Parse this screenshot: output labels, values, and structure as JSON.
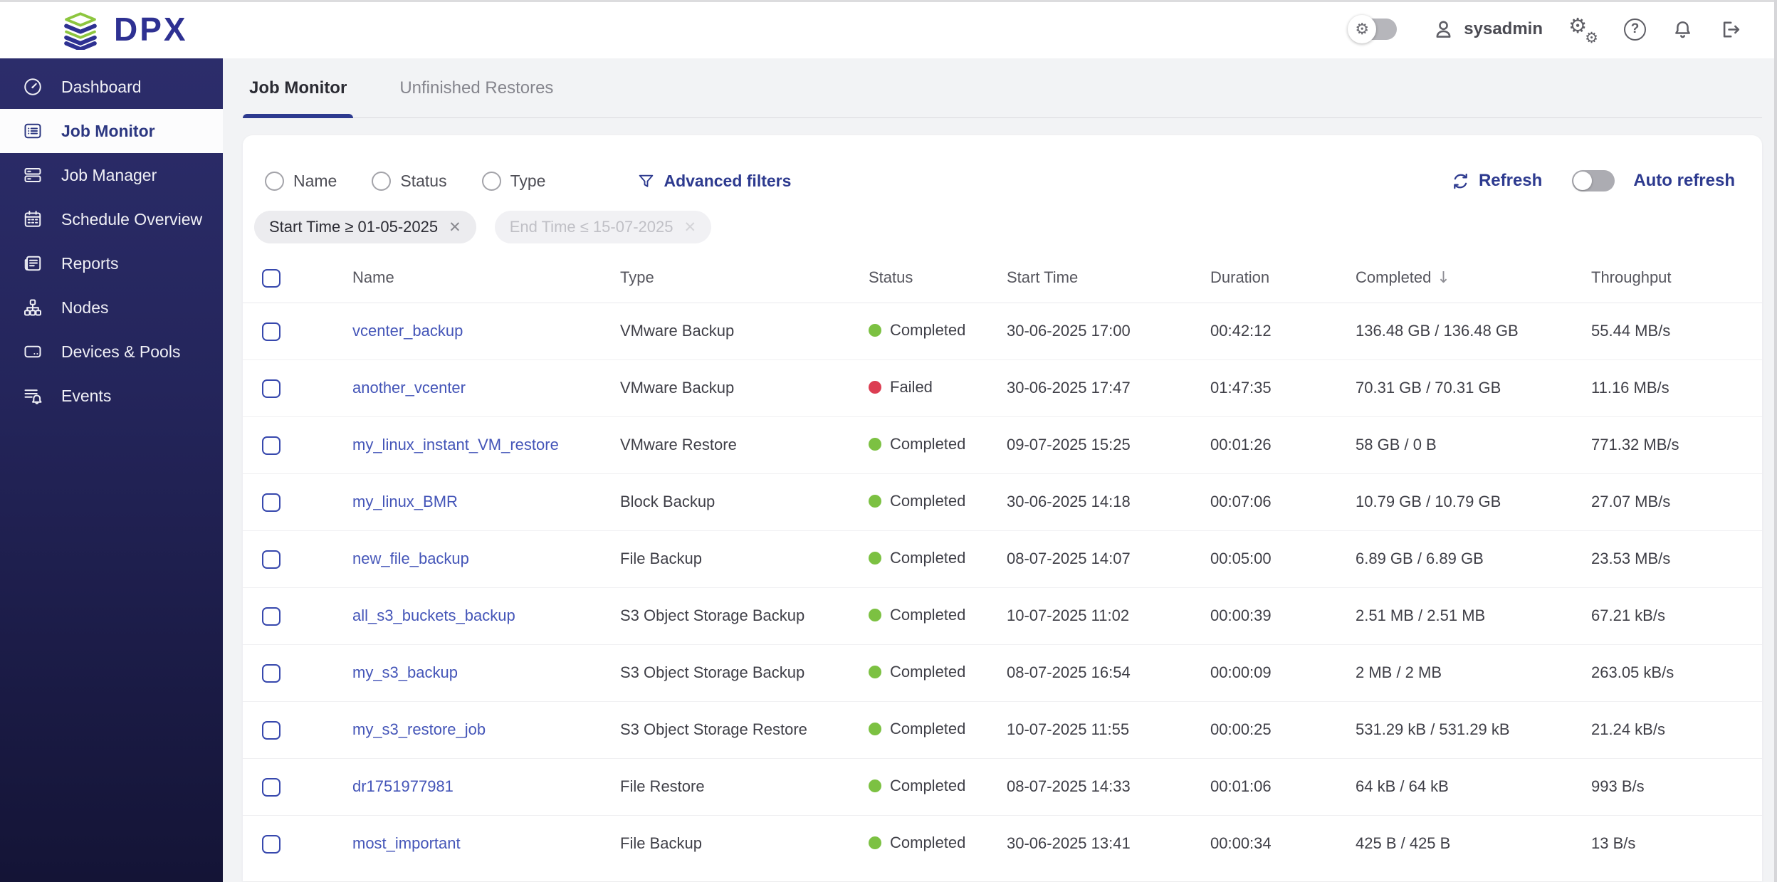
{
  "header": {
    "logo_text": "DPX",
    "username": "sysadmin",
    "gear_icon": "⚙",
    "help_icon": "?"
  },
  "sidebar": {
    "items": [
      {
        "label": "Dashboard",
        "active": false
      },
      {
        "label": "Job Monitor",
        "active": true
      },
      {
        "label": "Job Manager",
        "active": false
      },
      {
        "label": "Schedule Overview",
        "active": false
      },
      {
        "label": "Reports",
        "active": false
      },
      {
        "label": "Nodes",
        "active": false
      },
      {
        "label": "Devices & Pools",
        "active": false
      },
      {
        "label": "Events",
        "active": false
      }
    ]
  },
  "tabs": {
    "items": [
      {
        "label": "Job Monitor",
        "active": true
      },
      {
        "label": "Unfinished Restores",
        "active": false
      }
    ]
  },
  "filters": {
    "radios": [
      "Name",
      "Status",
      "Type"
    ],
    "advanced_label": "Advanced filters",
    "chips": [
      {
        "label": "Start Time ≥ 01-05-2025",
        "enabled": true
      },
      {
        "label": "End Time ≤ 15-07-2025",
        "enabled": false
      }
    ],
    "close_icon": "✕",
    "refresh_label": "Refresh",
    "auto_refresh_label": "Auto refresh",
    "auto_refresh_on": false
  },
  "table": {
    "columns": [
      "Name",
      "Type",
      "Status",
      "Start Time",
      "Duration",
      "Completed",
      "Throughput"
    ],
    "sort_column": "Completed",
    "sort_direction": "desc",
    "sort_icon": "↓",
    "rows": [
      {
        "name": "vcenter_backup",
        "type": "VMware Backup",
        "status": "Completed",
        "start_time": "30-06-2025 17:00",
        "duration": "00:42:12",
        "completed": "136.48 GB / 136.48 GB",
        "throughput": "55.44 MB/s"
      },
      {
        "name": "another_vcenter",
        "type": "VMware Backup",
        "status": "Failed",
        "start_time": "30-06-2025 17:47",
        "duration": "01:47:35",
        "completed": "70.31 GB / 70.31 GB",
        "throughput": "11.16 MB/s"
      },
      {
        "name": "my_linux_instant_VM_restore",
        "type": "VMware Restore",
        "status": "Completed",
        "start_time": "09-07-2025 15:25",
        "duration": "00:01:26",
        "completed": "58 GB / 0 B",
        "throughput": "771.32 MB/s"
      },
      {
        "name": "my_linux_BMR",
        "type": "Block Backup",
        "status": "Completed",
        "start_time": "30-06-2025 14:18",
        "duration": "00:07:06",
        "completed": "10.79 GB / 10.79 GB",
        "throughput": "27.07 MB/s"
      },
      {
        "name": "new_file_backup",
        "type": "File Backup",
        "status": "Completed",
        "start_time": "08-07-2025 14:07",
        "duration": "00:05:00",
        "completed": "6.89 GB / 6.89 GB",
        "throughput": "23.53 MB/s"
      },
      {
        "name": "all_s3_buckets_backup",
        "type": "S3 Object Storage Backup",
        "status": "Completed",
        "start_time": "10-07-2025 11:02",
        "duration": "00:00:39",
        "completed": "2.51 MB / 2.51 MB",
        "throughput": "67.21 kB/s"
      },
      {
        "name": "my_s3_backup",
        "type": "S3 Object Storage Backup",
        "status": "Completed",
        "start_time": "08-07-2025 16:54",
        "duration": "00:00:09",
        "completed": "2 MB / 2 MB",
        "throughput": "263.05 kB/s"
      },
      {
        "name": "my_s3_restore_job",
        "type": "S3 Object Storage Restore",
        "status": "Completed",
        "start_time": "10-07-2025 11:55",
        "duration": "00:00:25",
        "completed": "531.29 kB / 531.29 kB",
        "throughput": "21.24 kB/s"
      },
      {
        "name": "dr1751977981",
        "type": "File Restore",
        "status": "Completed",
        "start_time": "08-07-2025 14:33",
        "duration": "00:01:06",
        "completed": "64 kB / 64 kB",
        "throughput": "993 B/s"
      },
      {
        "name": "most_important",
        "type": "File Backup",
        "status": "Completed",
        "start_time": "30-06-2025 13:41",
        "duration": "00:00:34",
        "completed": "425 B / 425 B",
        "throughput": "13 B/s"
      }
    ]
  },
  "colors": {
    "accent": "#2e3192",
    "link": "#4455b8",
    "sidebar_top": "#2c2d6b",
    "sidebar_bottom": "#141436",
    "status": {
      "Completed": "#7cc142",
      "Failed": "#dc3d52"
    }
  }
}
